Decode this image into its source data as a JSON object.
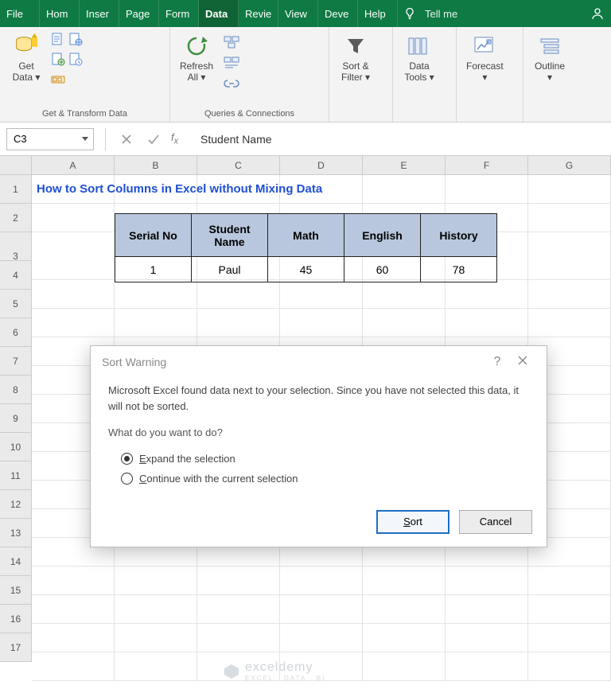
{
  "tabs": {
    "file": "File",
    "home": "Hom",
    "insert": "Inser",
    "page": "Page",
    "form": "Form",
    "data": "Data",
    "review": "Revie",
    "view": "View",
    "dev": "Deve",
    "help": "Help",
    "tellme": "Tell me"
  },
  "ribbon": {
    "get_data": "Get\nData ▾",
    "group_get": "Get & Transform Data",
    "refresh": "Refresh\nAll ▾",
    "group_queries": "Queries & Connections",
    "sortfilter": "Sort &\nFilter ▾",
    "datatools": "Data\nTools ▾",
    "forecast": "Forecast\n▾",
    "outline": "Outline\n▾"
  },
  "fx": {
    "namebox": "C3",
    "formula": "Student Name"
  },
  "cols": [
    "A",
    "B",
    "C",
    "D",
    "E",
    "F",
    "G"
  ],
  "rows": [
    "1",
    "2",
    "3",
    "4",
    "5",
    "6",
    "7",
    "8",
    "9",
    "10",
    "11",
    "12",
    "13",
    "14",
    "15",
    "16",
    "17"
  ],
  "sheet_title": "How to Sort Columns in Excel without Mixing Data",
  "table": {
    "headers": [
      "Serial No",
      "Student Name",
      "Math",
      "English",
      "History"
    ],
    "row1": [
      "1",
      "Paul",
      "45",
      "60",
      "78"
    ]
  },
  "dialog": {
    "title": "Sort Warning",
    "msg": "Microsoft Excel found data next to your selection.  Since you have not selected this data, it will not be sorted.",
    "question": "What do you want to do?",
    "opt1": "Expand the selection",
    "opt2": "Continue with the current selection",
    "sort": "Sort",
    "cancel": "Cancel"
  },
  "watermark": {
    "name": "exceldemy",
    "sub": "EXCEL · DATA · BI"
  }
}
